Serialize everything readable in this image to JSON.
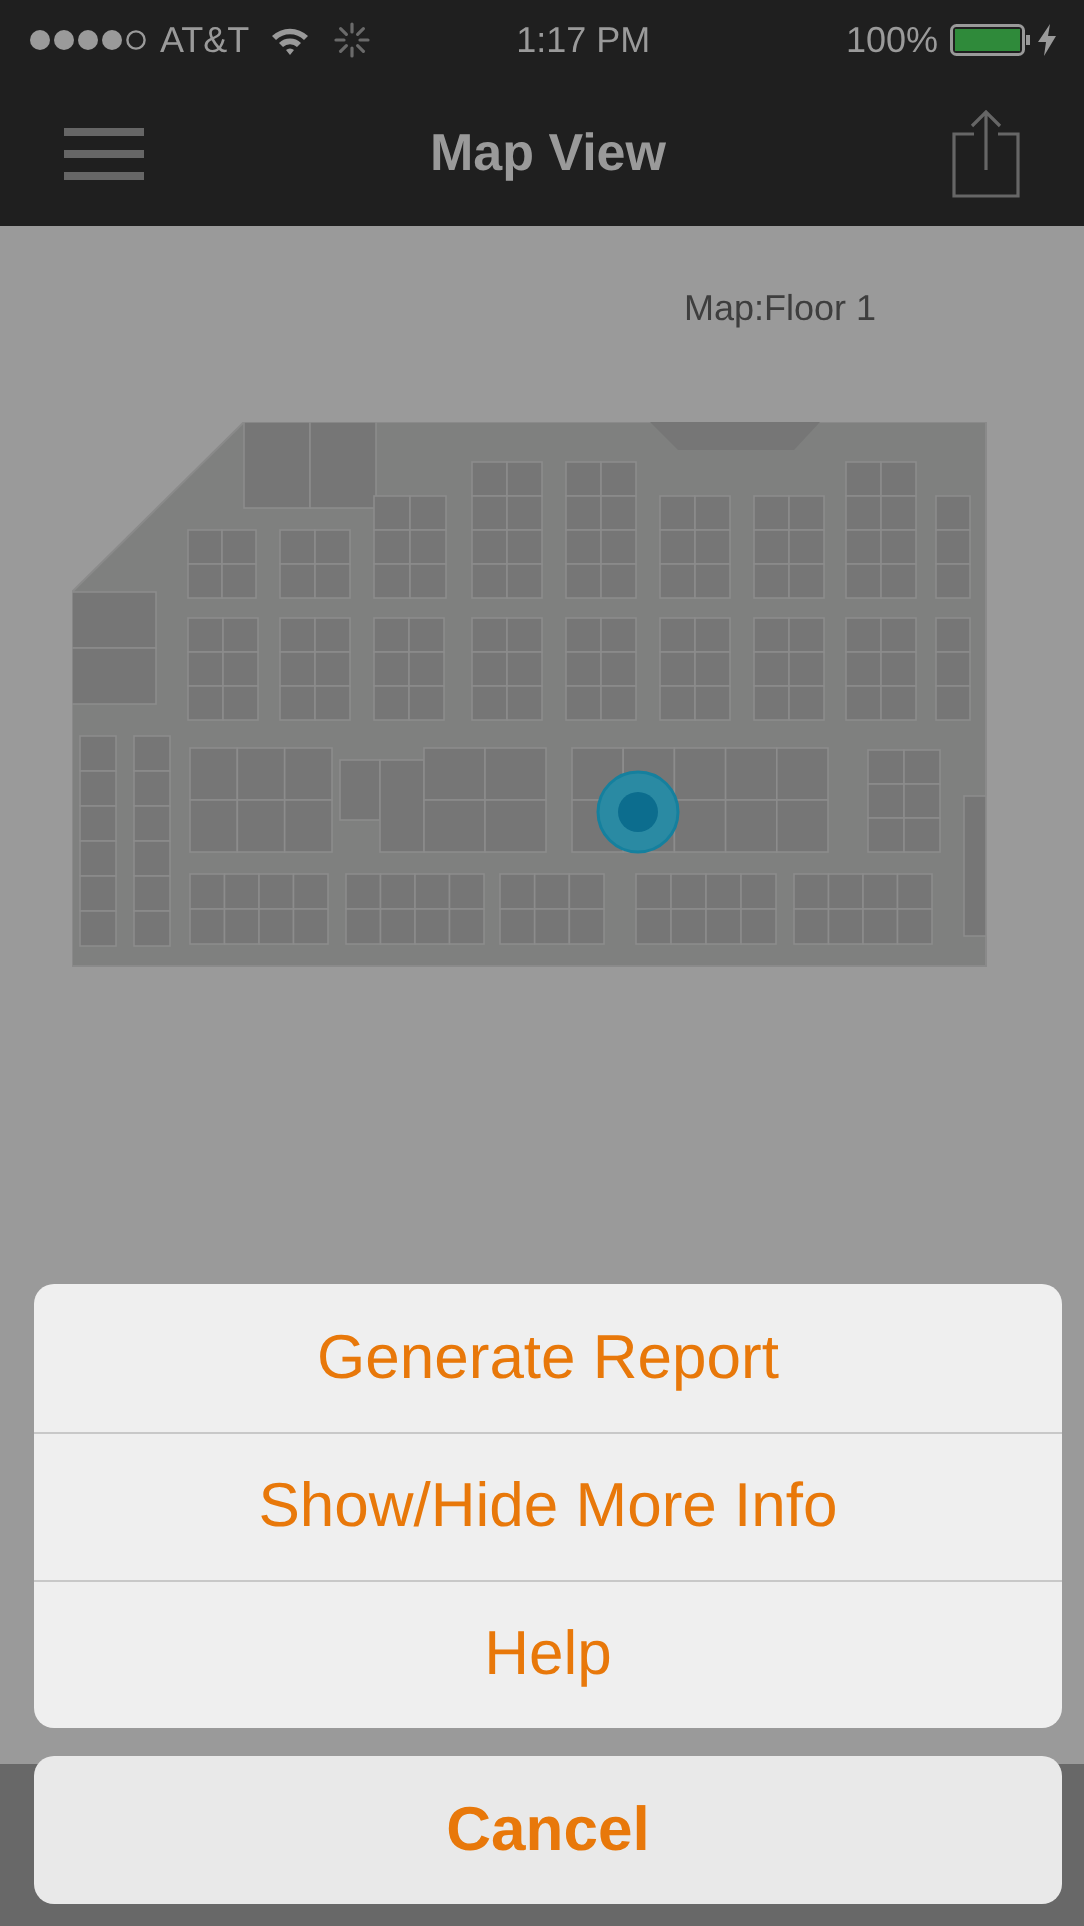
{
  "status_bar": {
    "carrier": "AT&T",
    "time": "1:17 PM",
    "battery": "100%"
  },
  "nav_bar": {
    "title": "Map View"
  },
  "map": {
    "label": "Map:Floor 1"
  },
  "action_sheet": {
    "actions": [
      {
        "label": "Generate Report"
      },
      {
        "label": "Show/Hide More Info"
      },
      {
        "label": "Help"
      }
    ],
    "cancel": "Cancel"
  }
}
